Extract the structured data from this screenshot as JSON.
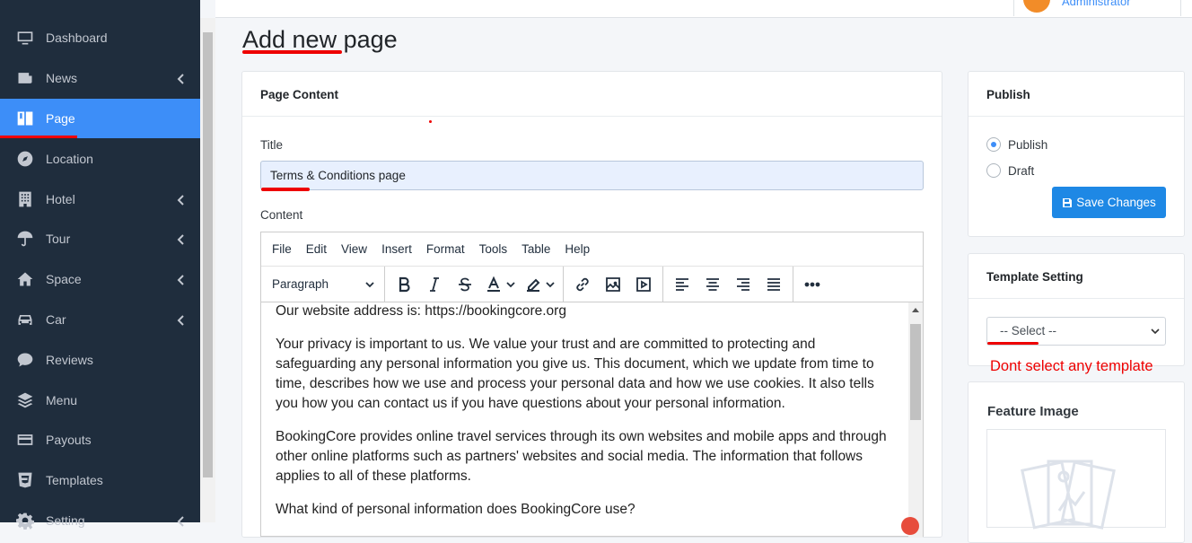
{
  "sidebar": {
    "items": [
      {
        "label": "Dashboard",
        "icon": "monitor-icon",
        "chevron": false
      },
      {
        "label": "News",
        "icon": "newspaper-icon",
        "chevron": true
      },
      {
        "label": "Page",
        "icon": "book-icon",
        "chevron": false,
        "active": true
      },
      {
        "label": "Location",
        "icon": "compass-icon",
        "chevron": false
      },
      {
        "label": "Hotel",
        "icon": "building-icon",
        "chevron": true
      },
      {
        "label": "Tour",
        "icon": "umbrella-icon",
        "chevron": true
      },
      {
        "label": "Space",
        "icon": "home-icon",
        "chevron": true
      },
      {
        "label": "Car",
        "icon": "car-icon",
        "chevron": true
      },
      {
        "label": "Reviews",
        "icon": "comment-icon",
        "chevron": false
      },
      {
        "label": "Menu",
        "icon": "layers-icon",
        "chevron": false
      },
      {
        "label": "Payouts",
        "icon": "credit-card-icon",
        "chevron": false
      },
      {
        "label": "Templates",
        "icon": "html5-icon",
        "chevron": false
      },
      {
        "label": "Setting",
        "icon": "gear-icon",
        "chevron": true
      }
    ]
  },
  "header": {
    "user_role": "Administrator"
  },
  "page": {
    "title": "Add new page"
  },
  "content_card": {
    "header": "Page Content",
    "title_label": "Title",
    "title_value": "Terms & Conditions page",
    "content_label": "Content"
  },
  "editor": {
    "menu": [
      "File",
      "Edit",
      "View",
      "Insert",
      "Format",
      "Tools",
      "Table",
      "Help"
    ],
    "block_format": "Paragraph",
    "paragraphs": [
      "Our website address is: https://bookingcore.org",
      "Your privacy is important to us. We value your trust and are committed to protecting and safeguarding any personal information you give us. This document, which we update from time to time, describes how we use and process your personal data and how we use cookies. It also tells you how you can contact us if you have questions about your personal information.",
      "BookingCore provides online travel services through its own websites and mobile apps and through other online platforms such as partners' websites and social media. The information that follows applies to all of these platforms.",
      "What kind of personal information does BookingCore use?"
    ]
  },
  "publish_card": {
    "header": "Publish",
    "options": [
      "Publish",
      "Draft"
    ],
    "selected": "Publish",
    "save_label": "Save Changes"
  },
  "template_card": {
    "header": "Template Setting",
    "select_value": "-- Select --",
    "note": "Dont select any template"
  },
  "feature_card": {
    "header": "Feature Image"
  },
  "colors": {
    "sidebar_bg": "#1f2d3d",
    "active": "#3d8ef8",
    "primary_button": "#1e88e5",
    "annotation_red": "#e00"
  }
}
